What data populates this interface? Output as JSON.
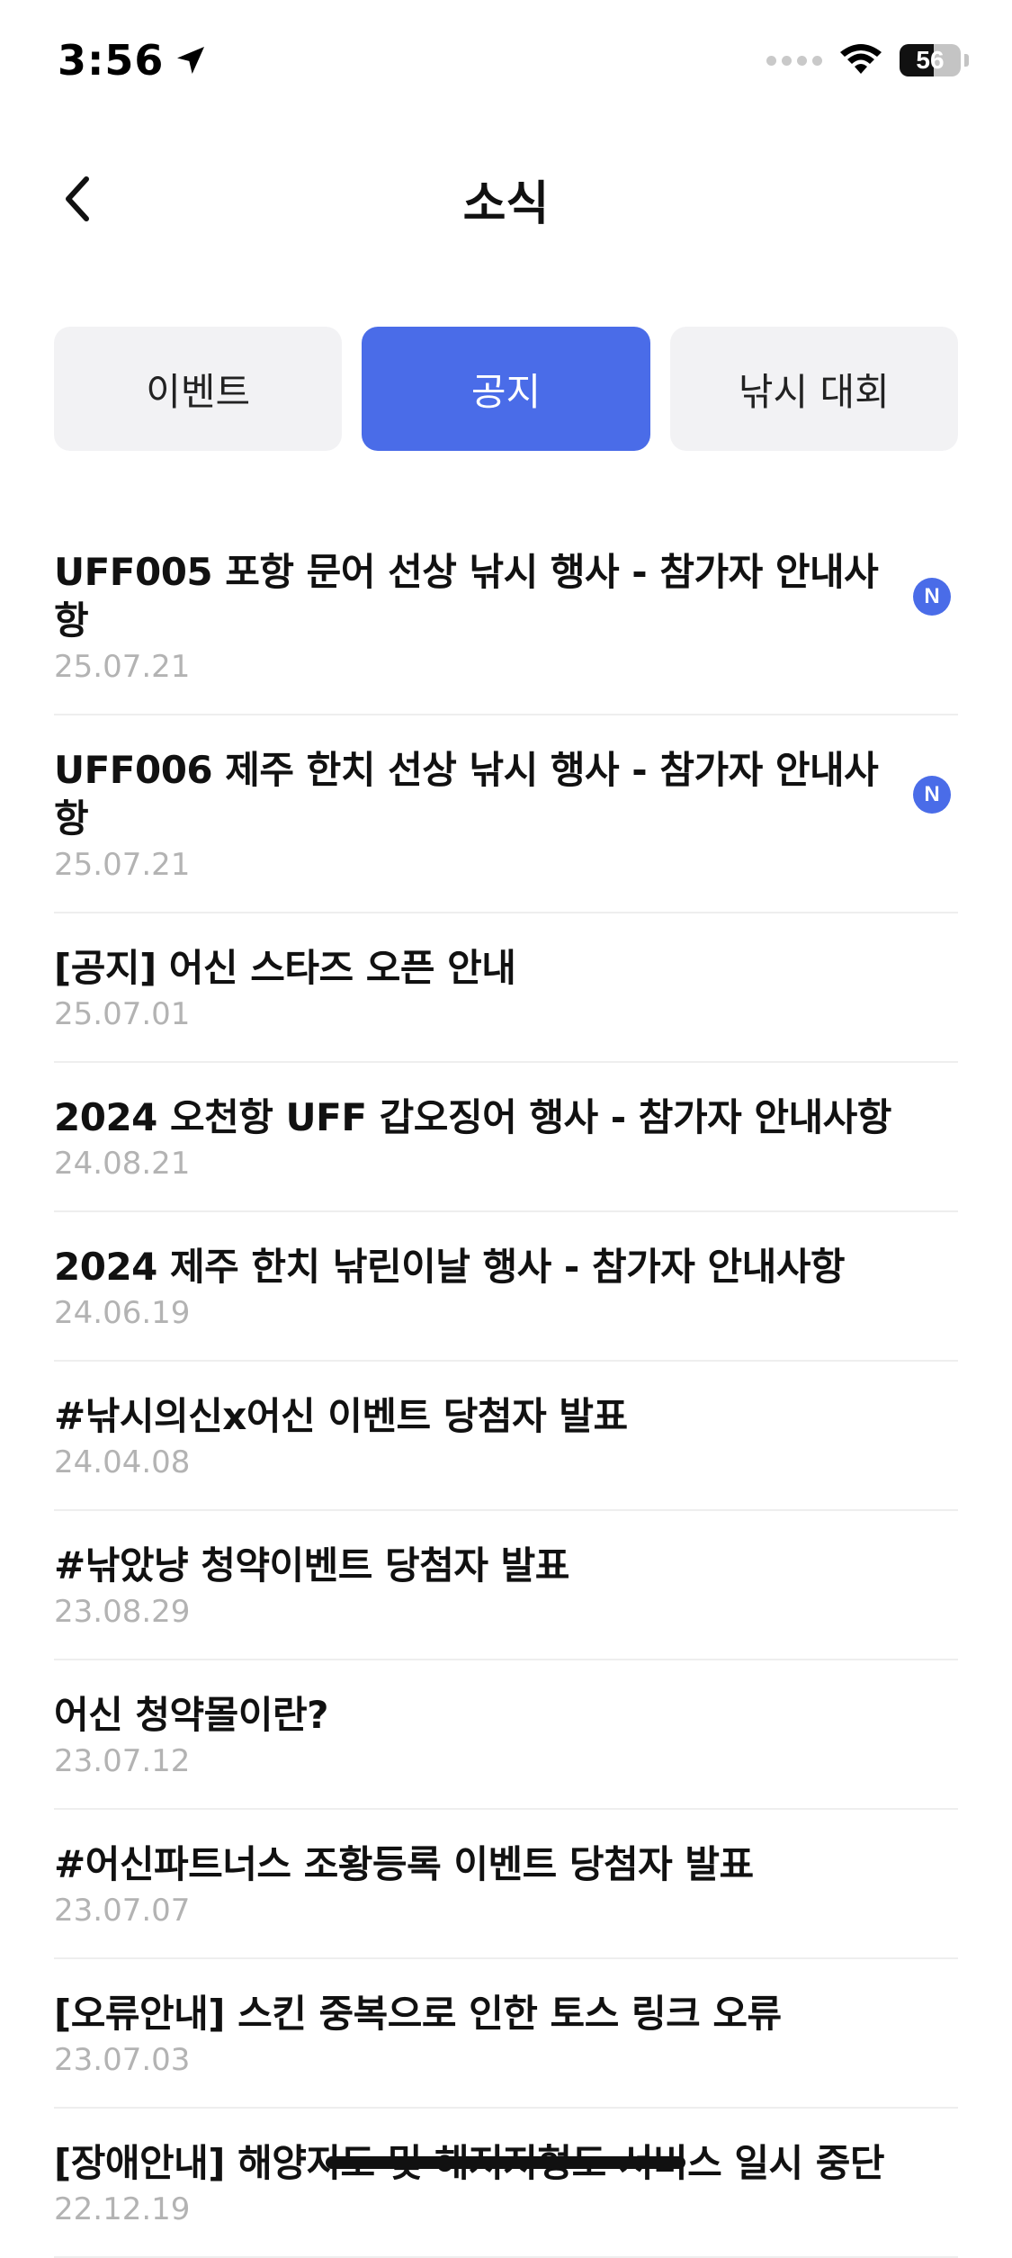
{
  "status_bar": {
    "time": "3:56",
    "battery": "56",
    "battery_level": 0.56
  },
  "header": {
    "title": "소식"
  },
  "tabs": [
    {
      "label": "이벤트",
      "active": false
    },
    {
      "label": "공지",
      "active": true
    },
    {
      "label": "낚시 대회",
      "active": false
    }
  ],
  "notices": [
    {
      "title": "UFF005 포항 문어 선상 낚시 행사 - 참가자 안내사항",
      "date": "25.07.21",
      "badge": "N"
    },
    {
      "title": "UFF006 제주 한치 선상 낚시 행사 - 참가자 안내사항",
      "date": "25.07.21",
      "badge": "N"
    },
    {
      "title": "[공지] 어신 스타즈 오픈 안내",
      "date": "25.07.01"
    },
    {
      "title": "2024 오천항 UFF 갑오징어 행사 - 참가자 안내사항",
      "date": "24.08.21"
    },
    {
      "title": "2024 제주 한치 낚린이날 행사 - 참가자 안내사항",
      "date": "24.06.19"
    },
    {
      "title": "#낚시의신x어신 이벤트 당첨자 발표",
      "date": "24.04.08"
    },
    {
      "title": "#낚았냥 청약이벤트 당첨자 발표",
      "date": "23.08.29"
    },
    {
      "title": "어신 청약몰이란?",
      "date": "23.07.12"
    },
    {
      "title": "#어신파트너스 조황등록 이벤트 당첨자 발표",
      "date": "23.07.07"
    },
    {
      "title": "[오류안내] 스킨 중복으로 인한 토스 링크 오류",
      "date": "23.07.03"
    },
    {
      "title": "[장애안내] 해양지도 및 해저지형도 서비스 일시 중단",
      "date": "22.12.19"
    }
  ]
}
